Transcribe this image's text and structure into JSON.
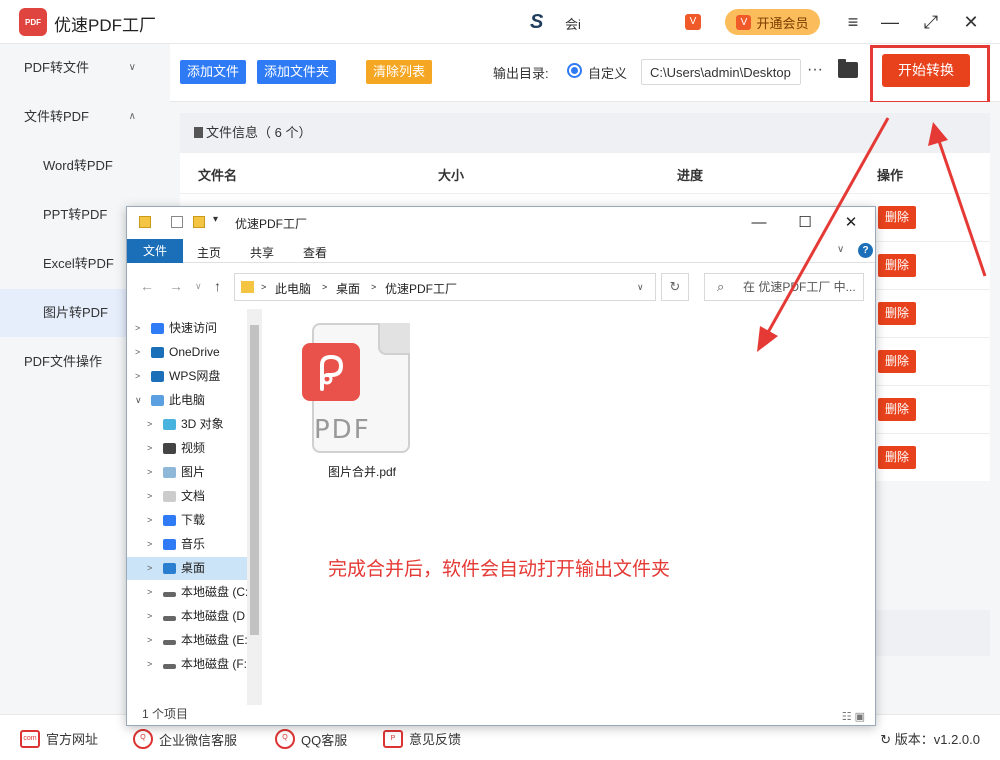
{
  "app": {
    "title": "优速PDF工厂",
    "logo_text": "PDF",
    "notice_text": "会i",
    "vip_label": "开通会员",
    "win_menu": "≡",
    "win_min": "—",
    "win_max": "⤢",
    "win_close": "✕"
  },
  "sidebar": {
    "items": [
      {
        "label": "PDF转文件",
        "chev": "∨"
      },
      {
        "label": "文件转PDF",
        "chev": "∧"
      },
      {
        "label": "Word转PDF"
      },
      {
        "label": "PPT转PDF"
      },
      {
        "label": "Excel转PDF"
      },
      {
        "label": "图片转PDF"
      },
      {
        "label": "PDF文件操作"
      }
    ]
  },
  "toolbar": {
    "add_file": "添加文件",
    "add_folder": "添加文件夹",
    "clear_list": "清除列表",
    "output_label": "输出目录:",
    "custom_label": "自定义",
    "output_path": "C:\\Users\\admin\\Desktop",
    "more": "···",
    "start": "开始转换"
  },
  "file_list": {
    "info": "文件信息（ 6 个）",
    "columns": [
      "文件名",
      "大小",
      "进度",
      "操作"
    ],
    "delete_label": "删除"
  },
  "footer": {
    "links": [
      {
        "label": "官方网址",
        "icon": "com"
      },
      {
        "label": "企业微信客服",
        "icon": "Q"
      },
      {
        "label": "QQ客服",
        "icon": "Q"
      },
      {
        "label": "意见反馈",
        "icon": "P"
      }
    ],
    "version": "版本：v1.2.0.0"
  },
  "explorer": {
    "title": "优速PDF工厂",
    "tabs": [
      "文件",
      "主页",
      "共享",
      "查看"
    ],
    "breadcrumb": [
      "此电脑",
      "桌面",
      "优速PDF工厂"
    ],
    "search_placeholder": "在 优速PDF工厂 中...",
    "tree": [
      {
        "label": "快速访问",
        "icon": "star-icon"
      },
      {
        "label": "OneDrive",
        "icon": "cloud-icon"
      },
      {
        "label": "WPS网盘",
        "icon": "cloud-icon"
      },
      {
        "label": "此电脑",
        "icon": "computer-icon"
      },
      {
        "label": "3D 对象",
        "icon": "cube-icon"
      },
      {
        "label": "视频",
        "icon": "film-icon"
      },
      {
        "label": "图片",
        "icon": "picture-icon"
      },
      {
        "label": "文档",
        "icon": "document-icon"
      },
      {
        "label": "下载",
        "icon": "download-icon"
      },
      {
        "label": "音乐",
        "icon": "music-icon"
      },
      {
        "label": "桌面",
        "icon": "desktop-icon"
      },
      {
        "label": "本地磁盘 (C:",
        "icon": "drive-icon"
      },
      {
        "label": "本地磁盘 (D",
        "icon": "drive-icon"
      },
      {
        "label": "本地磁盘 (E:",
        "icon": "drive-icon"
      },
      {
        "label": "本地磁盘 (F:",
        "icon": "drive-icon"
      }
    ],
    "file_name": "图片合并.pdf",
    "file_icon_text": "PDF",
    "status": "1 个项目"
  },
  "annotation": "完成合并后，软件会自动打开输出文件夹",
  "colors": {
    "accent_red": "#e8421c",
    "blue_button": "#2f7bf5",
    "orange_button": "#f5a623",
    "explorer_blue": "#1a6fb8"
  }
}
